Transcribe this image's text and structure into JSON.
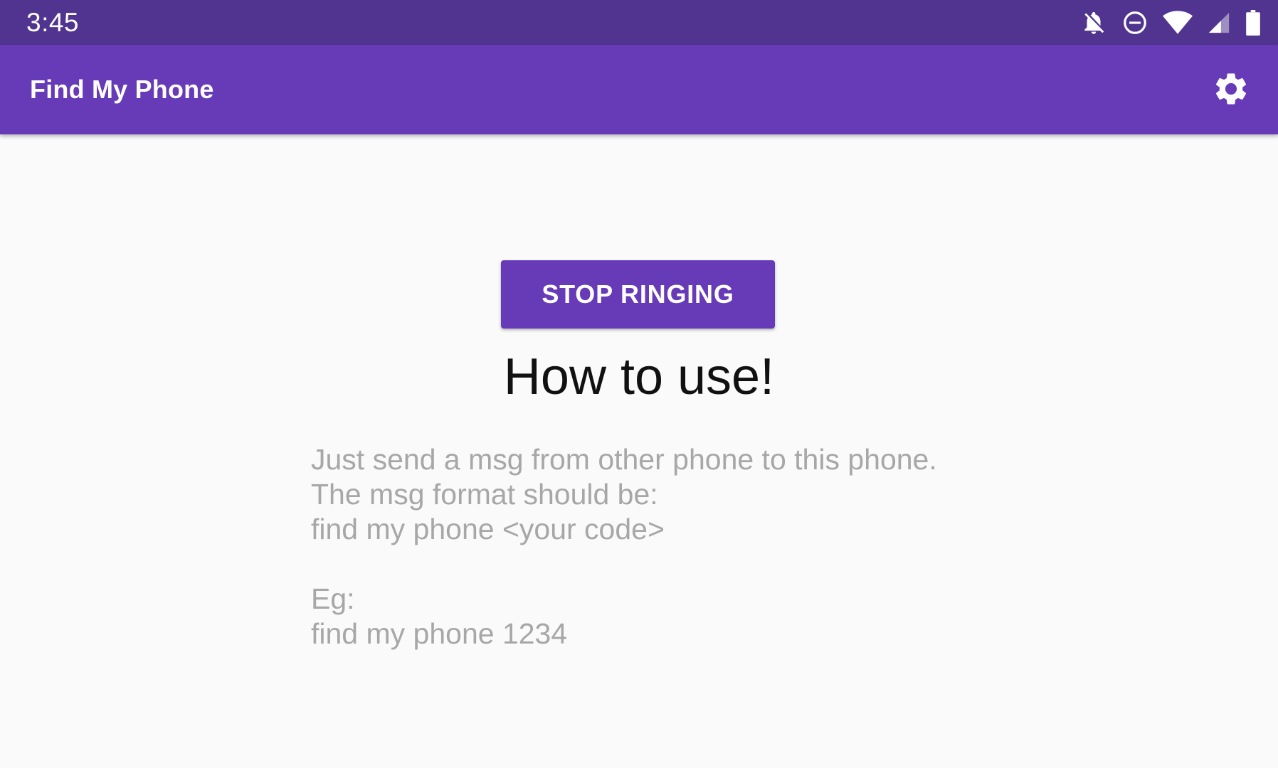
{
  "status_bar": {
    "time": "3:45",
    "icons": [
      "notifications-off-icon",
      "do-not-disturb-icon",
      "wifi-icon",
      "cell-signal-icon",
      "battery-icon"
    ]
  },
  "app_bar": {
    "title": "Find My Phone",
    "settings_icon": "gear-icon"
  },
  "main": {
    "stop_button_label": "STOP RINGING",
    "heading": "How to use!",
    "instructions": [
      "Just send a msg from other phone to this phone.",
      "The msg format should be:",
      "find my phone <your code>",
      "",
      "Eg:",
      "find my phone 1234"
    ]
  },
  "colors": {
    "status_bar": "#51348f",
    "primary": "#673ab7",
    "background": "#fafafa",
    "secondary_text": "#a7a7a7"
  }
}
